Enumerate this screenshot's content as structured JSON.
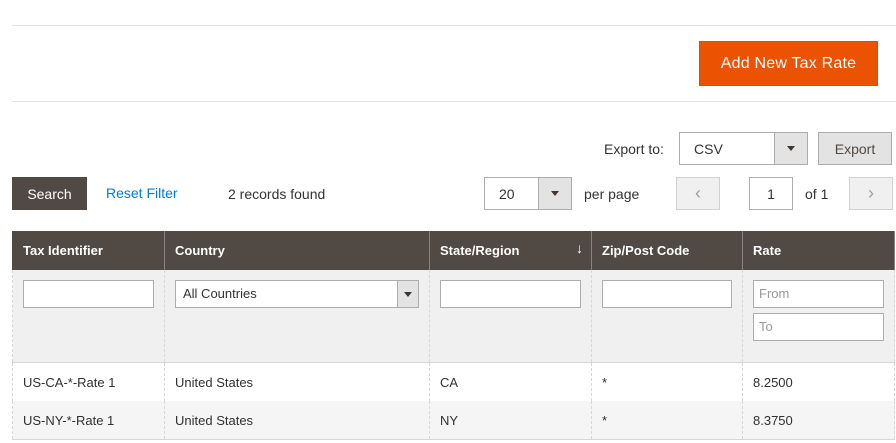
{
  "header": {
    "add_button": "Add New Tax Rate"
  },
  "export": {
    "label": "Export to:",
    "format": "CSV",
    "button": "Export"
  },
  "toolbar": {
    "search": "Search",
    "reset_filter": "Reset Filter",
    "records_found": "2 records found",
    "per_page_value": "20",
    "per_page_label": "per page",
    "prev_icon": "chevron-left-icon",
    "next_icon": "chevron-right-icon",
    "current_page": "1",
    "of_pages": "of 1"
  },
  "grid": {
    "columns": [
      "Tax Identifier",
      "Country",
      "State/Region",
      "Zip/Post Code",
      "Rate"
    ],
    "sorted_column": "State/Region",
    "filters": {
      "tax_identifier": "",
      "country": "All Countries",
      "state_region": "",
      "zip": "",
      "rate_from_placeholder": "From",
      "rate_to_placeholder": "To"
    },
    "rows": [
      [
        "US-CA-*-Rate 1",
        "United States",
        "CA",
        "*",
        "8.2500"
      ],
      [
        "US-NY-*-Rate 1",
        "United States",
        "NY",
        "*",
        "8.3750"
      ]
    ]
  },
  "colors": {
    "primary": "#eb5202",
    "header_bg": "#514943",
    "link": "#007bdb"
  }
}
